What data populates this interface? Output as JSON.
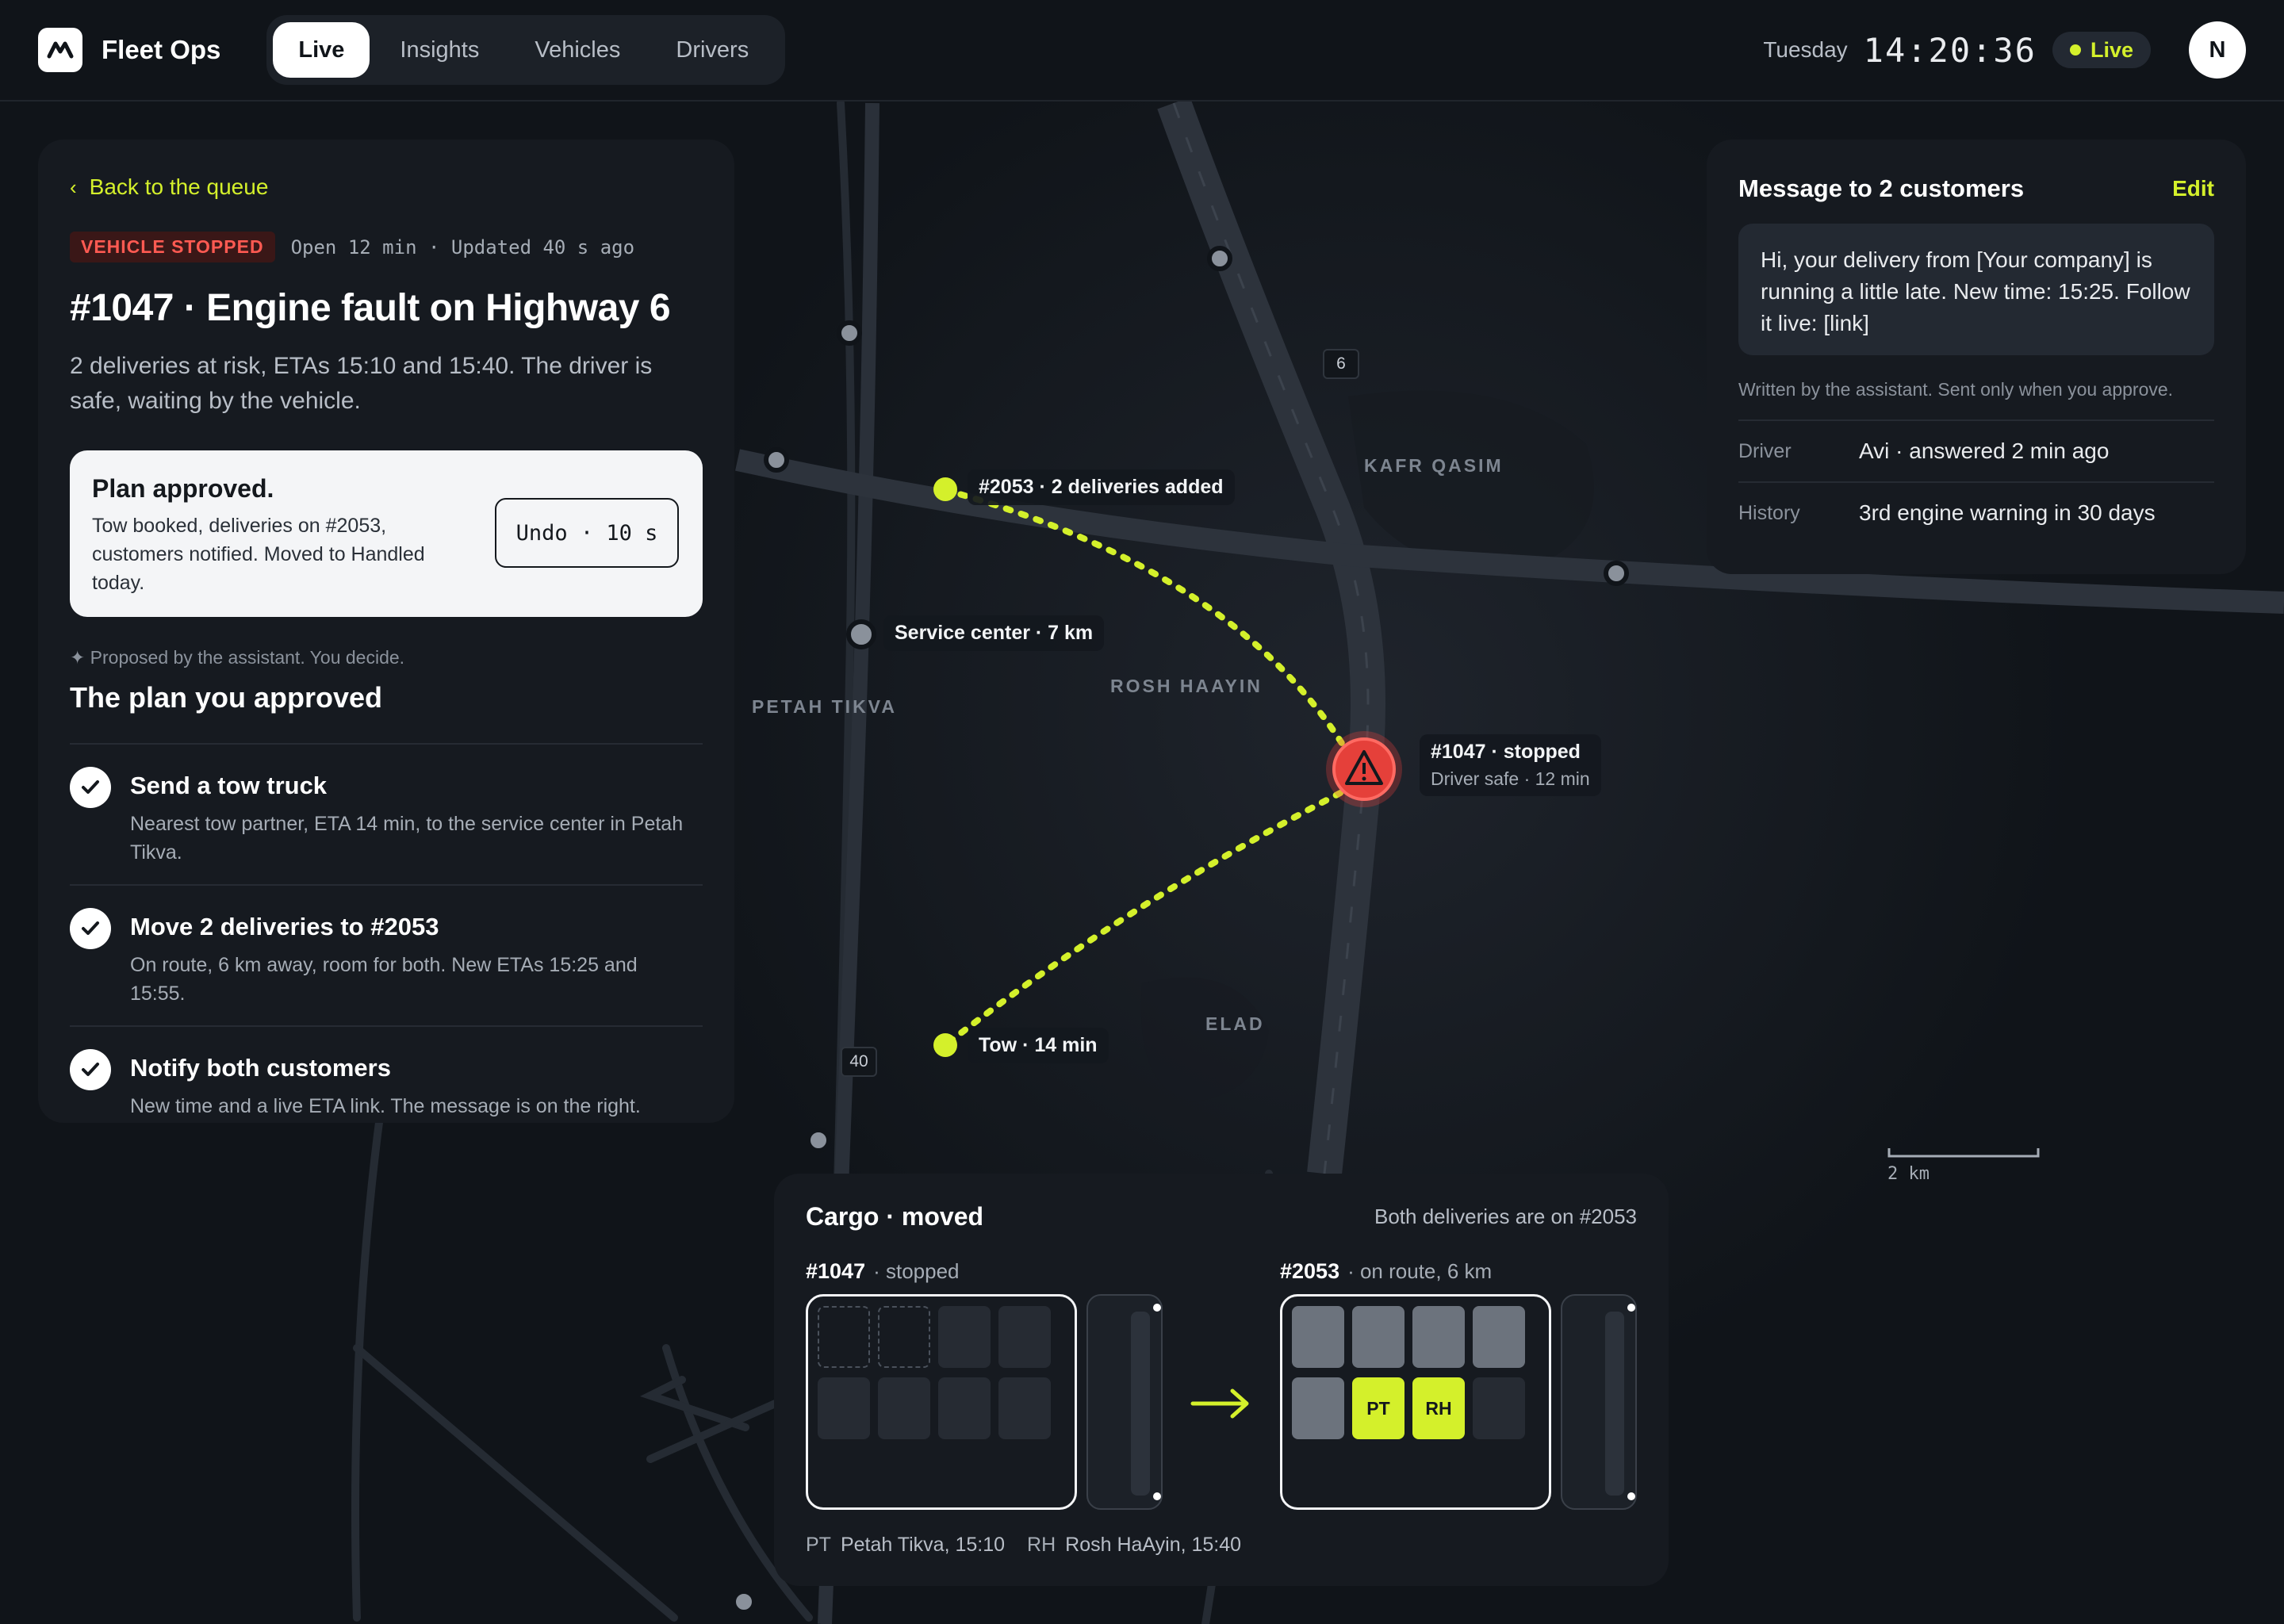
{
  "app": {
    "name": "Fleet Ops"
  },
  "nav": {
    "tabs": [
      "Live",
      "Insights",
      "Vehicles",
      "Drivers"
    ],
    "active": "Live"
  },
  "header": {
    "day": "Tuesday",
    "time": "14:20:36",
    "live_label": "Live",
    "avatar_initial": "N"
  },
  "incident": {
    "back_label": "Back to the queue",
    "badge": "VEHICLE STOPPED",
    "meta": "Open 12 min · Updated 40 s ago",
    "title": "#1047 · Engine fault on Highway 6",
    "description": "2 deliveries at risk, ETAs 15:10 and 15:40. The driver is safe, waiting by the vehicle."
  },
  "approved": {
    "title": "Plan approved.",
    "body": "Tow booked, deliveries on #2053, customers notified. Moved to Handled today.",
    "undo_label": "Undo · 10 s"
  },
  "plan": {
    "note": "✦ Proposed by the assistant. You decide.",
    "title": "The plan you approved",
    "steps": [
      {
        "title": "Send a tow truck",
        "desc": "Nearest tow partner, ETA 14 min, to the service center in Petah Tikva."
      },
      {
        "title": "Move 2 deliveries to #2053",
        "desc": "On route, 6 km away, room for both. New ETAs 15:25 and 15:55."
      },
      {
        "title": "Notify both customers",
        "desc": "New time and a live ETA link. The message is on the right."
      }
    ]
  },
  "message": {
    "title": "Message to 2 customers",
    "edit_label": "Edit",
    "body": "Hi, your delivery from [Your company] is running a little late. New time: 15:25. Follow it live: [link]",
    "note": "Written by the assistant. Sent only when you approve.",
    "rows": [
      {
        "key": "Driver",
        "value": "Avi · answered 2 min ago"
      },
      {
        "key": "History",
        "value": "3rd engine warning in 30 days"
      }
    ]
  },
  "map": {
    "labels": {
      "kafr_qasim": "KAFR QASIM",
      "petah_tikva": "PETAH TIKVA",
      "rosh_haayin": "ROSH HAAYIN",
      "elad": "ELAD"
    },
    "shields": {
      "hwy6": "6",
      "hwy40": "40"
    },
    "pins": {
      "v2053": "#2053 · 2 deliveries added",
      "service": "Service center · 7 km",
      "tow": "Tow · 14 min",
      "v1047_title": "#1047 · stopped",
      "v1047_sub": "Driver safe · 12 min"
    },
    "scale": "2 km",
    "colors": {
      "accent": "#d4f02b",
      "alert": "#e5403a"
    }
  },
  "cargo": {
    "title": "Cargo · moved",
    "subtitle": "Both deliveries are on #2053",
    "from": {
      "id": "#1047",
      "status": "· stopped"
    },
    "to": {
      "id": "#2053",
      "status": "· on route, 6 km"
    },
    "slots": {
      "pt": "PT",
      "rh": "RH"
    },
    "legend": [
      {
        "code": "PT",
        "label": "Petah Tikva, 15:10"
      },
      {
        "code": "RH",
        "label": "Rosh HaAyin, 15:40"
      }
    ]
  }
}
